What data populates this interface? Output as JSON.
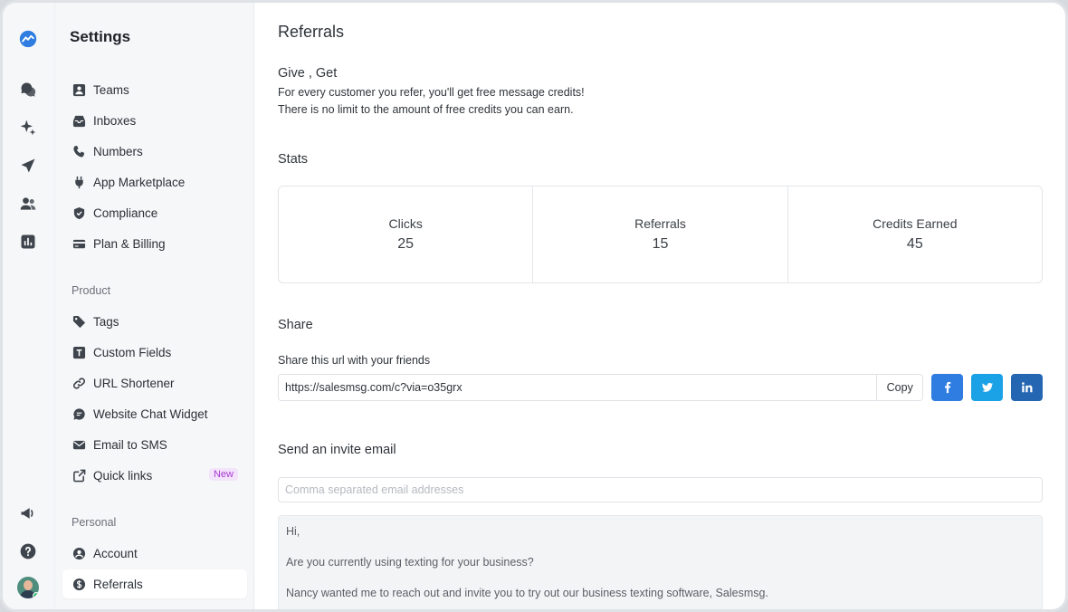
{
  "app": {
    "accent_color": "#2f7de1"
  },
  "rail": {
    "items": [
      "logo-icon",
      "chat-icon",
      "sparkle-icon",
      "send-icon",
      "contacts-icon",
      "reports-icon"
    ],
    "bottom_items": [
      "megaphone-icon",
      "help-icon",
      "avatar"
    ]
  },
  "sidebar": {
    "title": "Settings",
    "groups": [
      {
        "label": "",
        "items": [
          {
            "label": "Teams",
            "icon": "person-badge-icon"
          },
          {
            "label": "Inboxes",
            "icon": "inbox-icon"
          },
          {
            "label": "Numbers",
            "icon": "phone-icon"
          },
          {
            "label": "App Marketplace",
            "icon": "plug-icon"
          },
          {
            "label": "Compliance",
            "icon": "shield-icon"
          },
          {
            "label": "Plan & Billing",
            "icon": "credit-card-icon"
          }
        ]
      },
      {
        "label": "Product",
        "items": [
          {
            "label": "Tags",
            "icon": "tag-icon"
          },
          {
            "label": "Custom Fields",
            "icon": "text-field-icon"
          },
          {
            "label": "URL Shortener",
            "icon": "link-icon"
          },
          {
            "label": "Website Chat Widget",
            "icon": "chat-bubble-icon"
          },
          {
            "label": "Email to SMS",
            "icon": "envelope-icon"
          },
          {
            "label": "Quick links",
            "icon": "external-link-icon",
            "badge": "New"
          }
        ]
      },
      {
        "label": "Personal",
        "items": [
          {
            "label": "Account",
            "icon": "user-circle-icon"
          },
          {
            "label": "Referrals",
            "icon": "dollar-icon",
            "active": true
          }
        ]
      }
    ]
  },
  "main": {
    "title": "Referrals",
    "give_get": {
      "heading": "Give , Get",
      "line1": "For every customer you refer, you'll get free message credits!",
      "line2": "There is no limit to the amount of free credits you can earn."
    },
    "stats": {
      "heading": "Stats",
      "items": [
        {
          "label": "Clicks",
          "value": "25"
        },
        {
          "label": "Referrals",
          "value": "15"
        },
        {
          "label": "Credits Earned",
          "value": "45"
        }
      ]
    },
    "share": {
      "heading": "Share",
      "caption": "Share this url with your friends",
      "url": "https://salesmsg.com/c?via=o35grx",
      "copy_label": "Copy",
      "facebook_color": "#2f7de1",
      "twitter_color": "#1ba1e6",
      "linkedin_color": "#2466b2"
    },
    "invite": {
      "heading": "Send an invite email",
      "email_placeholder": "Comma separated email addresses",
      "message_lines": [
        "Hi,",
        "Are you currently using texting for your business?",
        "Nancy wanted me to reach out and invite you to try out our business texting software, Salesmsg."
      ]
    }
  }
}
